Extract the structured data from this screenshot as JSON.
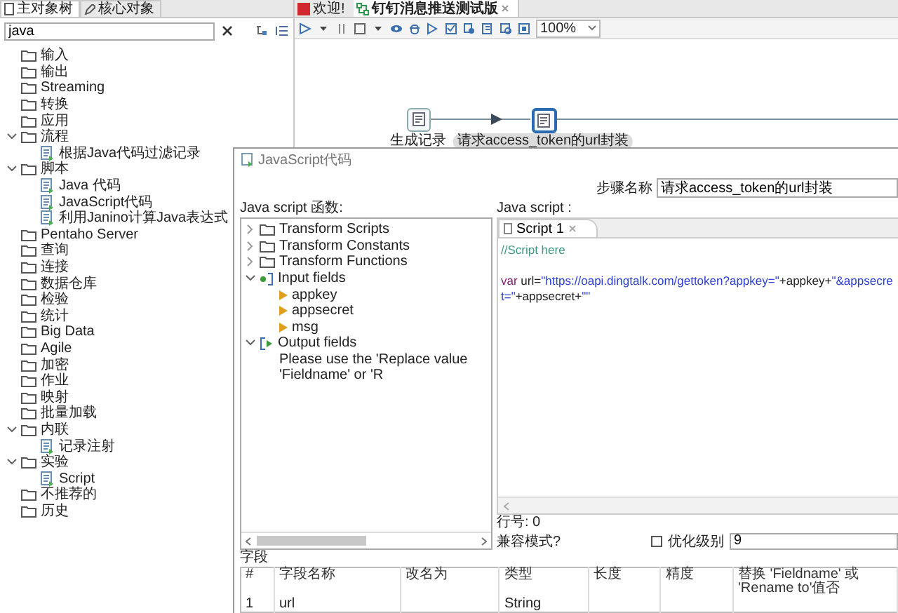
{
  "left_panel": {
    "tabs": [
      {
        "label": "主对象树",
        "selected": true
      },
      {
        "label": "核心对象",
        "selected": false
      }
    ],
    "search": {
      "value": "java"
    },
    "tree": [
      {
        "label": "输入",
        "kind": "folder"
      },
      {
        "label": "输出",
        "kind": "folder"
      },
      {
        "label": "Streaming",
        "kind": "folder"
      },
      {
        "label": "转换",
        "kind": "folder"
      },
      {
        "label": "应用",
        "kind": "folder"
      },
      {
        "label": "流程",
        "kind": "folder",
        "expanded": true,
        "children": [
          {
            "label": "根据Java代码过滤记录",
            "kind": "step"
          }
        ]
      },
      {
        "label": "脚本",
        "kind": "folder",
        "expanded": true,
        "children": [
          {
            "label": "Java 代码",
            "kind": "step"
          },
          {
            "label": "JavaScript代码",
            "kind": "step"
          },
          {
            "label": "利用Janino计算Java表达式",
            "kind": "step"
          }
        ]
      },
      {
        "label": "Pentaho Server",
        "kind": "folder"
      },
      {
        "label": "查询",
        "kind": "folder"
      },
      {
        "label": "连接",
        "kind": "folder"
      },
      {
        "label": "数据仓库",
        "kind": "folder"
      },
      {
        "label": "检验",
        "kind": "folder"
      },
      {
        "label": "统计",
        "kind": "folder"
      },
      {
        "label": "Big Data",
        "kind": "folder"
      },
      {
        "label": "Agile",
        "kind": "folder"
      },
      {
        "label": "加密",
        "kind": "folder"
      },
      {
        "label": "作业",
        "kind": "folder"
      },
      {
        "label": "映射",
        "kind": "folder"
      },
      {
        "label": "批量加载",
        "kind": "folder"
      },
      {
        "label": "内联",
        "kind": "folder",
        "expanded": true,
        "children": [
          {
            "label": "记录注射",
            "kind": "step"
          }
        ]
      },
      {
        "label": "实验",
        "kind": "folder",
        "expanded": true,
        "children": [
          {
            "label": "Script",
            "kind": "step"
          }
        ]
      },
      {
        "label": "不推荐的",
        "kind": "folder"
      },
      {
        "label": "历史",
        "kind": "folder"
      }
    ]
  },
  "editor_tabs": [
    {
      "label": "欢迎!",
      "kind": "welcome",
      "selected": false
    },
    {
      "label": "钉钉消息推送测试版",
      "kind": "transformation",
      "selected": true
    }
  ],
  "zoom": {
    "value": "100%"
  },
  "canvas": {
    "steps": [
      {
        "label": "生成记录",
        "selected": false
      },
      {
        "label": "请求access_token的url封装",
        "selected": true
      }
    ]
  },
  "dialog": {
    "title": "JavaScript代码",
    "step_name_label": "步骤名称",
    "step_name": "请求access_token的url封装",
    "functions_label": "Java script 函数:",
    "functions_tree": [
      {
        "label": "Transform Scripts",
        "kind": "folder",
        "expanded": false
      },
      {
        "label": "Transform Constants",
        "kind": "folder",
        "expanded": false
      },
      {
        "label": "Transform Functions",
        "kind": "folder",
        "expanded": false
      },
      {
        "label": "Input fields",
        "kind": "input",
        "expanded": true,
        "children": [
          {
            "label": "appkey",
            "kind": "field"
          },
          {
            "label": "appsecret",
            "kind": "field"
          },
          {
            "label": "msg",
            "kind": "field"
          }
        ]
      },
      {
        "label": "Output fields",
        "kind": "output",
        "expanded": true,
        "children": [
          {
            "label": "Please use the 'Replace value 'Fieldname' or 'R",
            "kind": "note"
          }
        ]
      }
    ],
    "script_label": "Java script :",
    "script_tabs": [
      {
        "label": "Script 1",
        "selected": true
      }
    ],
    "code_lines": [
      {
        "tokens": [
          {
            "kind": "comment",
            "text": "//Script here"
          }
        ]
      },
      {
        "tokens": [
          {
            "kind": "keyword",
            "text": "var"
          },
          {
            "kind": "plain",
            "text": " url="
          },
          {
            "kind": "string",
            "text": "\"https://oapi.dingtalk.com/gettoken?appkey=\""
          },
          {
            "kind": "plain",
            "text": "+appkey+"
          },
          {
            "kind": "string",
            "text": "\"&appsecret=\""
          },
          {
            "kind": "plain",
            "text": "+appsecret+"
          },
          {
            "kind": "string",
            "text": "\"\""
          }
        ]
      }
    ],
    "line_number": "行号: 0",
    "compat_label": "兼容模式?",
    "optimization": {
      "label": "优化级别",
      "checked": false,
      "value": "9"
    },
    "fields_label": "字段",
    "table": {
      "columns": [
        "#",
        "字段名称",
        "改名为",
        "类型",
        "长度",
        "精度",
        "替换 'Fieldname' 或 'Rename to'值否"
      ],
      "rows": [
        {
          "index": "1",
          "field_name": "url",
          "type": "String"
        }
      ]
    }
  }
}
